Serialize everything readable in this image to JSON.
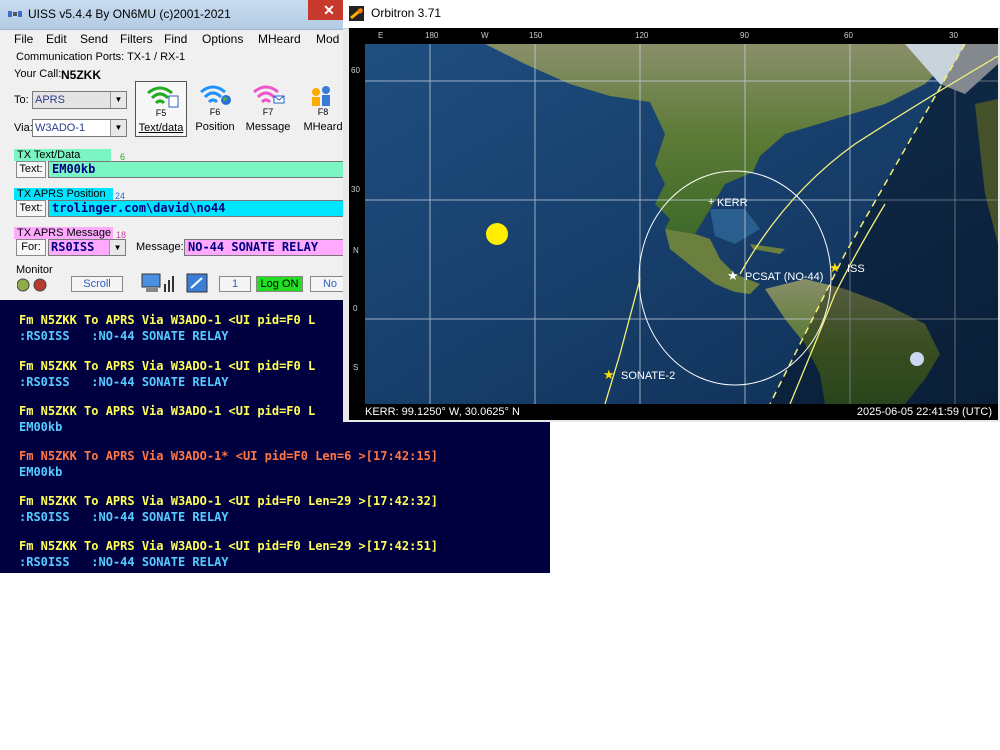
{
  "uiss": {
    "title": "UISS v5.4.4 By ON6MU (c)2001-2021",
    "close_label": "✕",
    "menu": [
      "File",
      "Edit",
      "Send",
      "Filters",
      "Find",
      "Options",
      "MHeard",
      "Mod"
    ],
    "comm_ports": "Communication Ports: TX-1 / RX-1",
    "your_call_label": "Your Call:",
    "your_call": "N5ZKK",
    "to_label": "To:",
    "to_value": "APRS",
    "via_label": "Via:",
    "via_value": "W3ADO-1",
    "fbuttons": [
      {
        "key": "F5",
        "label": "Text/data",
        "icon": "wifi-text-icon",
        "color": "#22aa22"
      },
      {
        "key": "F6",
        "label": "Position",
        "icon": "wifi-globe-icon",
        "color": "#1e90ff"
      },
      {
        "key": "F7",
        "label": "Message",
        "icon": "wifi-mail-icon",
        "color": "#ee55cc"
      },
      {
        "key": "F8",
        "label": "MHeard",
        "icon": "people-icon",
        "color": "#ffaa00"
      }
    ],
    "tx_text": {
      "header": "TX Text/Data",
      "count": "6",
      "label": "Text:",
      "value": "EM00kb",
      "color": "#7cf5c4"
    },
    "tx_position": {
      "header": "TX APRS Position",
      "count": "24",
      "label": "Text:",
      "value": "trolinger.com\\david\\no44",
      "color": "#00e5ff"
    },
    "tx_message": {
      "header": "TX APRS Message",
      "count": "18",
      "for_label": "For:",
      "for_value": "RS0ISS",
      "message_label": "Message:",
      "message_value": "NO-44 SONATE RELAY",
      "color": "#ffaaff"
    },
    "monitor": {
      "label": "Monitor",
      "scroll": "Scroll",
      "counter": "1",
      "log": "Log ON",
      "no": "No"
    },
    "console": [
      {
        "header": "Fm N5ZKK To APRS Via W3ADO-1 <UI pid=F0 L",
        "body": ":RS0ISS   :NO-44 SONATE RELAY",
        "hl": false
      },
      {
        "header": "Fm N5ZKK To APRS Via W3ADO-1 <UI pid=F0 L",
        "body": ":RS0ISS   :NO-44 SONATE RELAY",
        "hl": false
      },
      {
        "header": "Fm N5ZKK To APRS Via W3ADO-1 <UI pid=F0 L",
        "body": "EM00kb",
        "hl": false
      },
      {
        "header": "Fm N5ZKK To APRS Via W3ADO-1* <UI pid=F0 Len=6 >[17:42:15]",
        "body": "EM00kb",
        "hl": true
      },
      {
        "header": "Fm N5ZKK To APRS Via W3ADO-1 <UI pid=F0 Len=29 >[17:42:32]",
        "body": ":RS0ISS   :NO-44 SONATE RELAY",
        "hl": false
      },
      {
        "header": "Fm N5ZKK To APRS Via W3ADO-1 <UI pid=F0 Len=29 >[17:42:51]",
        "body": ":RS0ISS   :NO-44 SONATE RELAY",
        "hl": false
      }
    ]
  },
  "orbitron": {
    "title": "Orbitron 3.71",
    "top_scale": [
      "E",
      "180",
      "W",
      "150",
      "120",
      "90",
      "60",
      "30"
    ],
    "left_scale": [
      "60",
      "30",
      "N",
      "0",
      "S"
    ],
    "ground_station": "KERR",
    "satellites": [
      "PCSAT (NO-44)",
      "ISS",
      "SONATE-2"
    ],
    "status_left": "KERR: 99.1250° W, 30.0625° N",
    "status_right": "2025-06-05 22:41:59 (UTC)",
    "colors": {
      "track": "#f5f07a",
      "sat": "#ffe000",
      "sun": "#ffee00",
      "ocean": "#153a66",
      "land": "#556b2f",
      "grid": "#c8d2e0"
    }
  }
}
